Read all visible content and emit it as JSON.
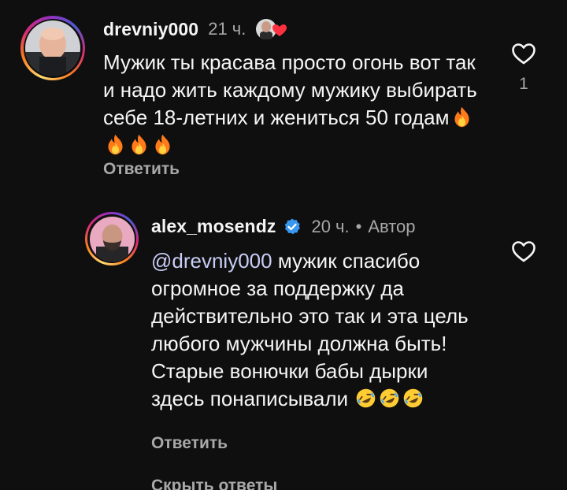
{
  "comment_1": {
    "username": "drevniy000",
    "time": "21 ч.",
    "text": "Мужик ты красава просто огонь вот так и надо жить каждому мужику выбирать себе 18-летних и жениться 50 годам",
    "emoji_trailing": "🔥🔥🔥🔥",
    "reply_label": "Ответить",
    "like_count": "1",
    "liked_by_author_icon": "heart-badge-icon"
  },
  "comment_2": {
    "username": "alex_mosendz",
    "verified_icon": "verified-badge-icon",
    "time": "20 ч.",
    "separator": "•",
    "author_label": "Автор",
    "mention": "@drevniy000",
    "text": " мужик спасибо огромное за поддержку да действительно это так и эта цель любого мужчины должна быть! Старые вонючки бабы дырки здесь понаписывали ",
    "emoji_trailing": "🤣🤣🤣",
    "reply_label": "Ответить"
  },
  "hide_replies_label": "Скрыть ответы",
  "colors": {
    "background": "#0f0f0f",
    "text_primary": "#f5f5f5",
    "text_secondary": "#a8a8a8",
    "verified_blue": "#3897f0",
    "heart_red": "#ff3040"
  }
}
